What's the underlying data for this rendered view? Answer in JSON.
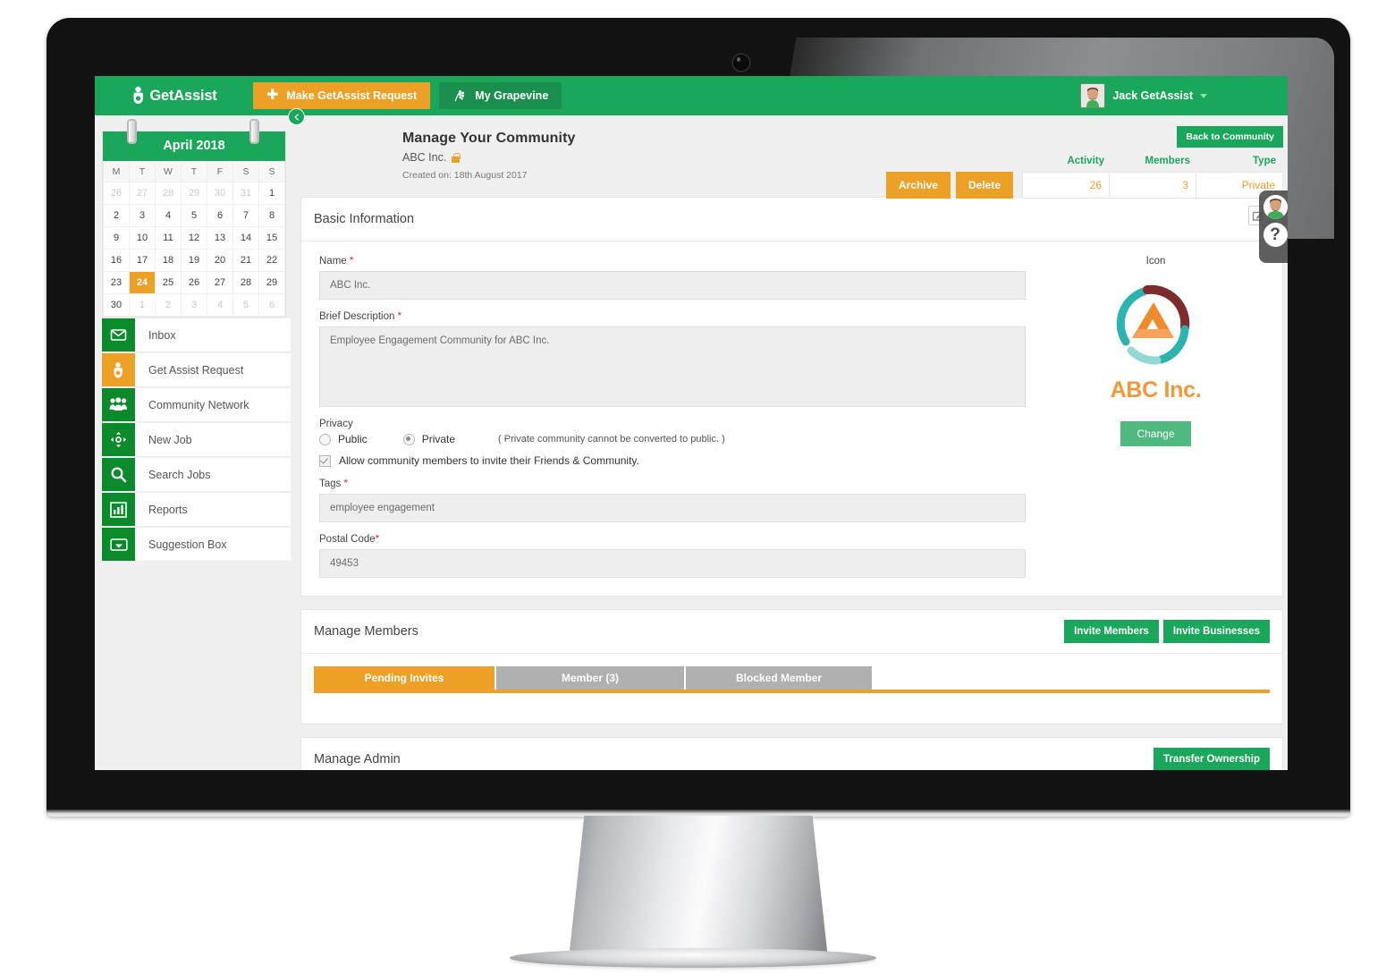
{
  "topbar": {
    "brand": "GetAssist",
    "make_request_label": "Make GetAssist Request",
    "grapevine_label": "My Grapevine",
    "user_name": "Jack GetAssist"
  },
  "calendar": {
    "month_label": "April 2018",
    "weekdays": [
      "M",
      "T",
      "W",
      "T",
      "F",
      "S",
      "S"
    ],
    "selected_day": "24",
    "weeks": [
      [
        {
          "d": "26",
          "o": true
        },
        {
          "d": "27",
          "o": true
        },
        {
          "d": "28",
          "o": true
        },
        {
          "d": "29",
          "o": true
        },
        {
          "d": "30",
          "o": true
        },
        {
          "d": "31",
          "o": true
        },
        {
          "d": "1",
          "o": false
        }
      ],
      [
        {
          "d": "2",
          "o": false
        },
        {
          "d": "3",
          "o": false
        },
        {
          "d": "4",
          "o": false
        },
        {
          "d": "5",
          "o": false
        },
        {
          "d": "6",
          "o": false
        },
        {
          "d": "7",
          "o": false
        },
        {
          "d": "8",
          "o": false
        }
      ],
      [
        {
          "d": "9",
          "o": false
        },
        {
          "d": "10",
          "o": false
        },
        {
          "d": "11",
          "o": false
        },
        {
          "d": "12",
          "o": false
        },
        {
          "d": "13",
          "o": false
        },
        {
          "d": "14",
          "o": false
        },
        {
          "d": "15",
          "o": false
        }
      ],
      [
        {
          "d": "16",
          "o": false
        },
        {
          "d": "17",
          "o": false
        },
        {
          "d": "18",
          "o": false
        },
        {
          "d": "19",
          "o": false
        },
        {
          "d": "20",
          "o": false
        },
        {
          "d": "21",
          "o": false
        },
        {
          "d": "22",
          "o": false
        }
      ],
      [
        {
          "d": "23",
          "o": false
        },
        {
          "d": "24",
          "o": false,
          "sel": true
        },
        {
          "d": "25",
          "o": false
        },
        {
          "d": "26",
          "o": false
        },
        {
          "d": "27",
          "o": false
        },
        {
          "d": "28",
          "o": false
        },
        {
          "d": "29",
          "o": false
        }
      ],
      [
        {
          "d": "30",
          "o": false
        },
        {
          "d": "1",
          "o": true
        },
        {
          "d": "2",
          "o": true
        },
        {
          "d": "3",
          "o": true
        },
        {
          "d": "4",
          "o": true
        },
        {
          "d": "5",
          "o": true
        },
        {
          "d": "6",
          "o": true
        }
      ]
    ]
  },
  "sidebar": {
    "items": [
      {
        "label": "Inbox",
        "icon": "envelope-icon",
        "accent": "green"
      },
      {
        "label": "Get Assist Request",
        "icon": "person-assist-icon",
        "accent": "amber"
      },
      {
        "label": "Community Network",
        "icon": "people-group-icon",
        "accent": "green"
      },
      {
        "label": "New Job",
        "icon": "move-arrows-icon",
        "accent": "green"
      },
      {
        "label": "Search Jobs",
        "icon": "magnifier-icon",
        "accent": "green"
      },
      {
        "label": "Reports",
        "icon": "bar-chart-icon",
        "accent": "green"
      },
      {
        "label": "Suggestion Box",
        "icon": "inbox-tray-icon",
        "accent": "green"
      }
    ]
  },
  "page": {
    "title": "Manage Your Community",
    "community_name": "ABC Inc.",
    "created_on": "Created on: 18th August 2017",
    "back_label": "Back to Community",
    "archive_label": "Archive",
    "delete_label": "Delete",
    "stats": [
      {
        "header": "Activity",
        "value": "26"
      },
      {
        "header": "Members",
        "value": "3"
      },
      {
        "header": "Type",
        "value": "Private"
      }
    ]
  },
  "basic_info": {
    "section_title": "Basic Information",
    "name_label": "Name",
    "name_value": "ABC Inc.",
    "desc_label": "Brief Description",
    "desc_value": "Employee Engagement Community for ABC Inc.",
    "privacy_label": "Privacy",
    "public_label": "Public",
    "private_label": "Private",
    "privacy_hint": "( Private community cannot be converted to public. )",
    "allow_invite_label": "Allow community members to invite their Friends & Community.",
    "tags_label": "Tags",
    "tags_value": "employee engagement",
    "postal_label": "Postal Code",
    "postal_value": "49453",
    "icon_caption": "Icon",
    "logo_text": "ABC Inc.",
    "change_label": "Change"
  },
  "manage_members": {
    "section_title": "Manage Members",
    "invite_members_label": "Invite Members",
    "invite_businesses_label": "Invite Businesses",
    "tabs": [
      {
        "label": "Pending Invites",
        "active": true
      },
      {
        "label": "Member (3)",
        "active": false
      },
      {
        "label": "Blocked Member",
        "active": false
      }
    ]
  },
  "manage_admin": {
    "section_title": "Manage Admin",
    "transfer_label": "Transfer Ownership"
  },
  "colors": {
    "brand_green": "#1aa75b",
    "accent_amber": "#eda026",
    "menu_green": "#0b8a2c",
    "logo_orange": "#f0993c"
  }
}
